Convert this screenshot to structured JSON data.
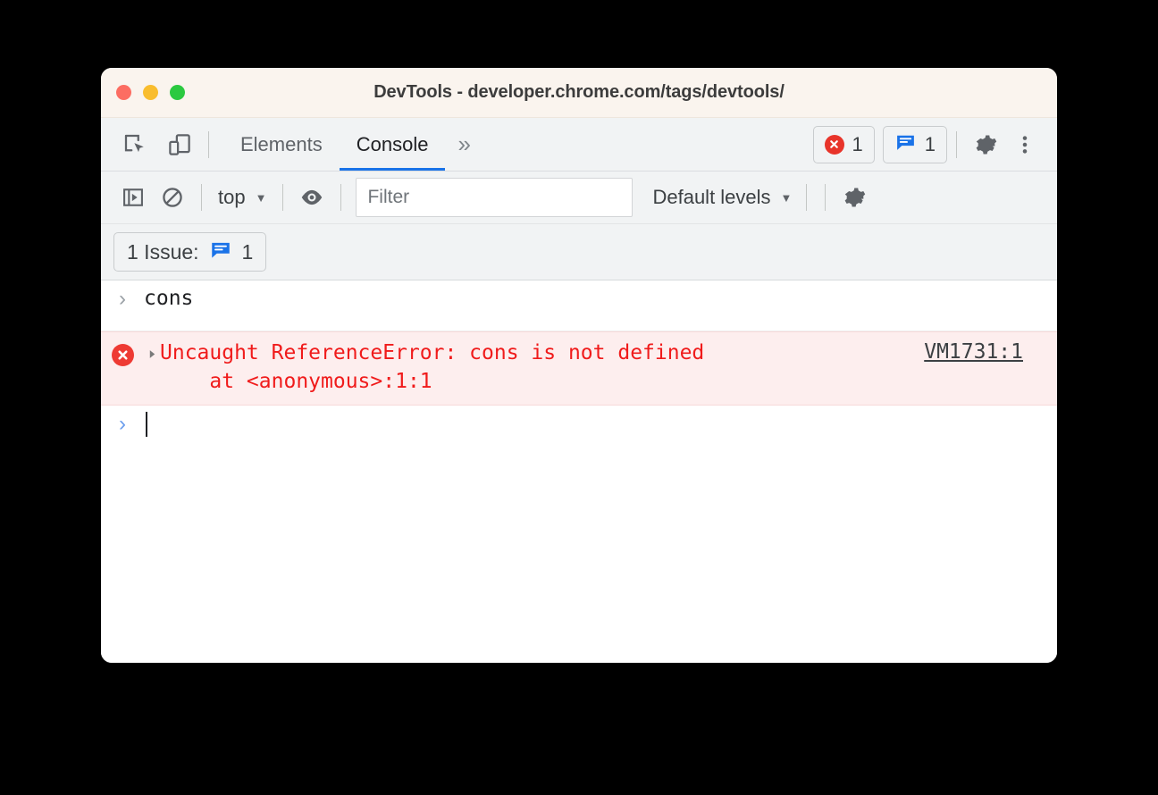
{
  "window": {
    "title": "DevTools - developer.chrome.com/tags/devtools/",
    "traffic_lights": [
      "close",
      "minimize",
      "maximize"
    ]
  },
  "tabbar": {
    "inspect_icon": "inspect-element-icon",
    "device_icon": "device-toolbar-icon",
    "tabs": [
      {
        "label": "Elements",
        "active": false
      },
      {
        "label": "Console",
        "active": true
      }
    ],
    "overflow_label": "»",
    "error_badge": {
      "icon": "error-circle-icon",
      "count": "1"
    },
    "issue_badge": {
      "icon": "issue-message-icon",
      "count": "1"
    },
    "settings_icon": "gear-icon",
    "more_icon": "kebab-menu-icon"
  },
  "console_toolbar": {
    "sidebar_toggle_icon": "console-sidebar-icon",
    "clear_icon": "clear-console-icon",
    "context": {
      "label": "top",
      "caret": "▼"
    },
    "eye_icon": "live-expression-eye-icon",
    "filter": {
      "placeholder": "Filter",
      "value": ""
    },
    "levels": {
      "label": "Default levels",
      "caret": "▼"
    },
    "settings_icon": "console-settings-gear-icon"
  },
  "issues_bar": {
    "label": "1 Issue:",
    "icon": "issue-message-icon",
    "count": "1"
  },
  "console": {
    "entries": [
      {
        "type": "input",
        "prompt": "›",
        "text": "cons"
      },
      {
        "type": "error",
        "disclosure": "▸",
        "message": "Uncaught ReferenceError: cons is not defined",
        "stack": "    at <anonymous>:1:1",
        "link": "VM1731:1"
      },
      {
        "type": "prompt",
        "prompt": "›",
        "text": ""
      }
    ]
  },
  "colors": {
    "titlebar": "#faf4ee",
    "toolbar": "#f1f3f4",
    "accent": "#1a73e8",
    "error_red": "#f01b1b",
    "error_bg": "#fdeeee",
    "badge_blue": "#1a73e8",
    "error_icon": "#ee3a33"
  }
}
